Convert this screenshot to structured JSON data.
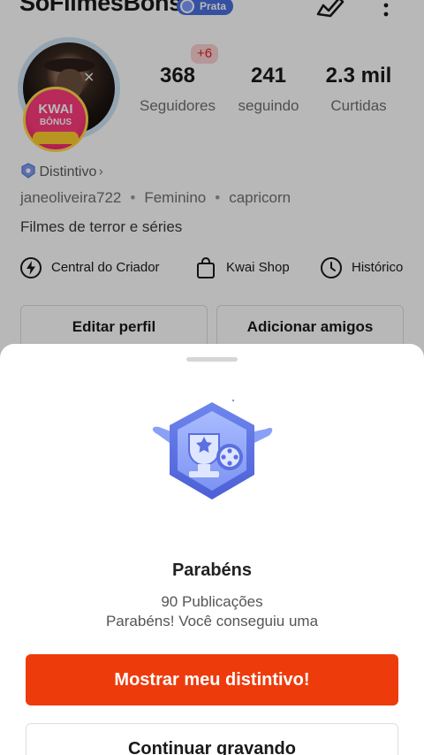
{
  "header": {
    "username": "SoFilmesBons",
    "tier_badge": "Prata",
    "edit_icon": "edit-pen-icon",
    "more_icon": "more-vertical-icon"
  },
  "avatar": {
    "promo_line1": "KWAI",
    "promo_line2": "BÔNUS",
    "close_glyph": "×"
  },
  "notification_badge": "+6",
  "stats": {
    "followers": {
      "value": "368",
      "label": "Seguidores"
    },
    "following": {
      "value": "241",
      "label": "seguindo"
    },
    "likes": {
      "value": "2.3 mil",
      "label": "Curtidas"
    }
  },
  "profile": {
    "distintivo_label": "Distintivo",
    "handle": "janeoliveira722",
    "gender": "Feminino",
    "sign": "capricorn",
    "separator": "•",
    "bio": "Filmes de terror e séries"
  },
  "quick_links": [
    {
      "label": "Central do Criador",
      "icon": "lightning-icon"
    },
    {
      "label": "Kwai Shop",
      "icon": "shopping-bag-icon"
    },
    {
      "label": "Histórico",
      "icon": "clock-icon"
    }
  ],
  "actions": {
    "edit_profile": "Editar perfil",
    "add_friends": "Adicionar amigos"
  },
  "sheet": {
    "title": "Parabéns",
    "subtitle_line1": "90 Publicações",
    "subtitle_line2": "Parabéns! Você conseguiu uma",
    "primary_button": "Mostrar meu distintivo!",
    "secondary_button": "Continuar gravando"
  },
  "colors": {
    "accent": "#ee3b0c",
    "badge_blue": "#4a6ee0",
    "notification_red": "#e02020"
  }
}
